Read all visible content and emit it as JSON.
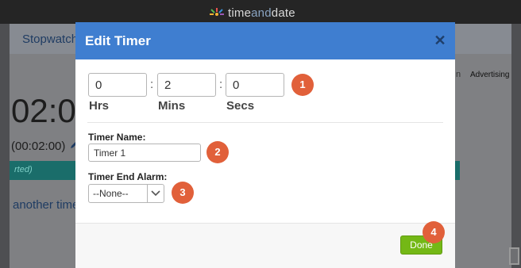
{
  "site": {
    "logo_text_a": "time",
    "logo_text_b": "and",
    "logo_text_c": "date"
  },
  "background": {
    "nav_tab": "Stopwatch",
    "big_time": "02:0",
    "small_time": "(00:02:00)",
    "teal_text": "rted)",
    "another_link": "another time",
    "n_text": "n",
    "advertising": "Advertising"
  },
  "modal": {
    "title": "Edit Timer",
    "close_label": "✕",
    "hours": {
      "value": "0",
      "label": "Hrs"
    },
    "minutes": {
      "value": "2",
      "label": "Mins"
    },
    "seconds": {
      "value": "0",
      "label": "Secs"
    },
    "separator": ":",
    "timer_name": {
      "label": "Timer Name:",
      "value": "Timer 1"
    },
    "end_alarm": {
      "label": "Timer End Alarm:",
      "selected": "--None--"
    },
    "done_label": "Done"
  },
  "badges": [
    "1",
    "2",
    "3",
    "4"
  ],
  "colors": {
    "header_blue": "#3f7ed0",
    "badge_orange": "#e1603a",
    "done_green": "#74b816",
    "teal_bar": "#1a6d6a"
  }
}
